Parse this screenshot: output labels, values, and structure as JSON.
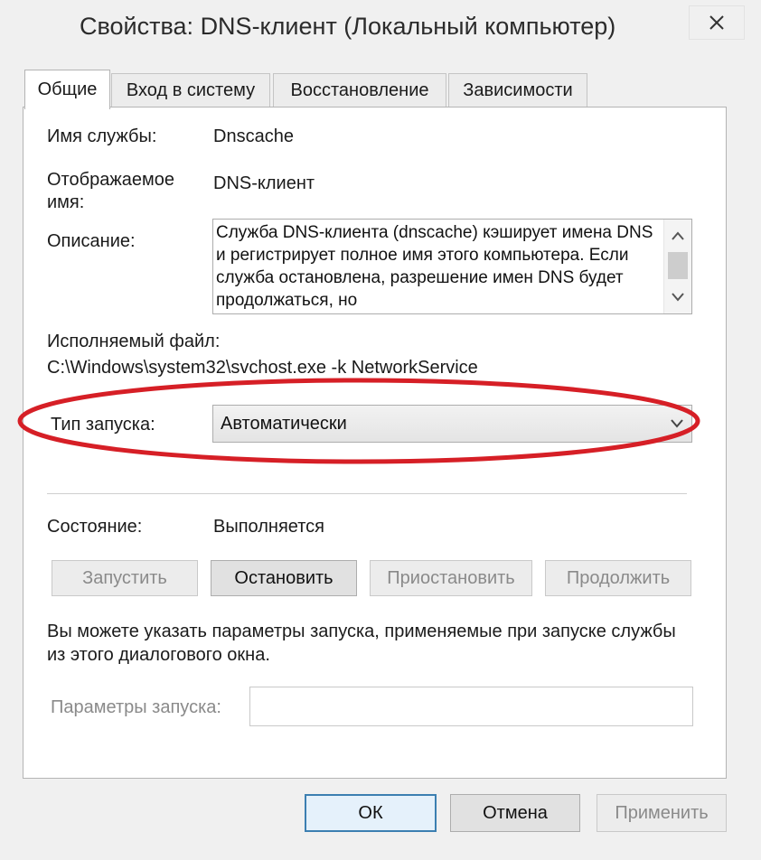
{
  "window": {
    "title": "Свойства: DNS-клиент (Локальный компьютер)",
    "close_icon": "close-icon"
  },
  "tabs": [
    {
      "label": "Общие",
      "active": true
    },
    {
      "label": "Вход в систему",
      "active": false
    },
    {
      "label": "Восстановление",
      "active": false
    },
    {
      "label": "Зависимости",
      "active": false
    }
  ],
  "general": {
    "service_name_label": "Имя службы:",
    "service_name_value": "Dnscache",
    "display_name_label_line1": "Отображаемое",
    "display_name_label_line2": "имя:",
    "display_name_value": "DNS-клиент",
    "description_label": "Описание:",
    "description_text": "Служба DNS-клиента (dnscache) кэширует имена DNS и регистрирует полное имя этого компьютера. Если служба остановлена, разрешение имен DNS будет продолжаться, но",
    "exe_label": "Исполняемый файл:",
    "exe_path": "C:\\Windows\\system32\\svchost.exe -k NetworkService",
    "startup_type_label": "Тип запуска:",
    "startup_type_value": "Автоматически",
    "status_label": "Состояние:",
    "status_value": "Выполняется"
  },
  "service_buttons": {
    "start": "Запустить",
    "stop": "Остановить",
    "pause": "Приостановить",
    "resume": "Продолжить"
  },
  "params": {
    "info_text": "Вы можете указать параметры запуска, применяемые при запуске службы из этого диалогового окна.",
    "label": "Параметры запуска:",
    "value": ""
  },
  "dialog_buttons": {
    "ok": "ОК",
    "cancel": "Отмена",
    "apply": "Применить"
  },
  "colors": {
    "highlight_ellipse": "#d61f26",
    "default_button_border": "#3c7fb1"
  }
}
